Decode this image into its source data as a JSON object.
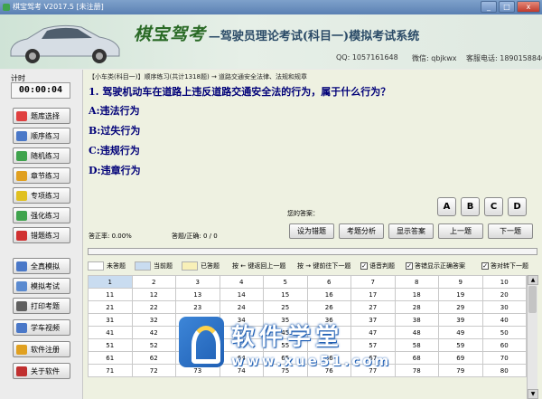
{
  "window": {
    "title": "棋宝驾考 V2017.5 [未注册]",
    "minimize": "_",
    "maximize": "□",
    "close": "x"
  },
  "header": {
    "brand": "棋宝驾考",
    "subtitle": "—驾驶员理论考试(科目一)模拟考试系统",
    "qq": "QQ: 1057161648",
    "wechat": "微信: qbjkwx",
    "phone": "客服电话: 18901588403"
  },
  "timer": {
    "label": "计时",
    "value": "00:00:04"
  },
  "menu": [
    {
      "label": "题库选择",
      "color": "#e04040"
    },
    {
      "label": "顺序练习",
      "color": "#4a78c8"
    },
    {
      "label": "随机练习",
      "color": "#3fa34d"
    },
    {
      "label": "章节练习",
      "color": "#e0a020"
    },
    {
      "label": "专项练习",
      "color": "#e0c020"
    },
    {
      "label": "强化练习",
      "color": "#3fa34d"
    },
    {
      "label": "错题练习",
      "color": "#d03030"
    },
    {
      "label": "全真模拟",
      "color": "#4a78c8"
    },
    {
      "label": "模拟考试",
      "color": "#5a8ad0"
    },
    {
      "label": "打印考题",
      "color": "#606060"
    },
    {
      "label": "学车视频",
      "color": "#4a78c8"
    },
    {
      "label": "软件注册",
      "color": "#e0a020"
    },
    {
      "label": "关于软件",
      "color": "#c03030"
    }
  ],
  "question": {
    "breadcrumb": "【小车类(科目一)】顺序练习(共计1318题)  →  道路交通安全法律、法规和规章",
    "title": "1. 驾驶机动车在道路上违反道路交通安全法的行为，属于什么行为？",
    "options": [
      "A:违法行为",
      "B:过失行为",
      "C:违规行为",
      "D:违章行为"
    ]
  },
  "answer": {
    "label": "您的答案：",
    "buttons": [
      "A",
      "B",
      "C",
      "D"
    ]
  },
  "stats": {
    "accuracy": "答正率: 0.00%",
    "count": "答题/正确: 0 / 0"
  },
  "functions": [
    "设为错题",
    "考题分析",
    "显示答案",
    "上一题",
    "下一题"
  ],
  "progress": {
    "value": 0
  },
  "legend": {
    "unanswered": "未答题",
    "current": "当前题",
    "answered": "已答题",
    "prev_key": "按 ← 键返回上一题",
    "next_key": "按 → 键前往下一题",
    "voice": "语音判题",
    "show_correct": "答错显示正确答案",
    "auto_next": "答对转下一题"
  },
  "colors": {
    "unanswered": "#ffffff",
    "current": "#c9dcf0",
    "answered": "#f8f0b8"
  },
  "grid_rows": [
    [
      "1",
      "2",
      "3",
      "4",
      "5",
      "6",
      "7",
      "8",
      "9",
      "10"
    ],
    [
      "11",
      "12",
      "13",
      "14",
      "15",
      "16",
      "17",
      "18",
      "19",
      "20"
    ],
    [
      "21",
      "22",
      "23",
      "24",
      "25",
      "26",
      "27",
      "28",
      "29",
      "30"
    ],
    [
      "31",
      "32",
      "33",
      "34",
      "35",
      "36",
      "37",
      "38",
      "39",
      "40"
    ],
    [
      "41",
      "42",
      "43",
      "44",
      "45",
      "46",
      "47",
      "48",
      "49",
      "50"
    ],
    [
      "51",
      "52",
      "53",
      "54",
      "55",
      "56",
      "57",
      "58",
      "59",
      "60"
    ],
    [
      "61",
      "62",
      "63",
      "64",
      "65",
      "66",
      "67",
      "68",
      "69",
      "70"
    ],
    [
      "71",
      "72",
      "73",
      "74",
      "75",
      "76",
      "77",
      "78",
      "79",
      "80"
    ]
  ],
  "watermark": {
    "text": "软件学堂",
    "url": "www.xue51.com"
  }
}
